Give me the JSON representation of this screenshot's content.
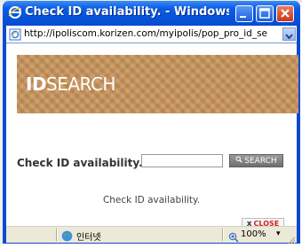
{
  "window": {
    "title": "Check ID availability. - Windows I...",
    "colors": {
      "titlebar": "#0553d8",
      "close_button": "#c6371b"
    }
  },
  "address_bar": {
    "url": "http://ipoliscom.korizen.com/myipolis/pop_pro_id_se"
  },
  "banner": {
    "title_bold": "ID",
    "title_light": "SEARCH",
    "color": "#c7935a"
  },
  "form": {
    "label": "Check ID availability.",
    "input_value": "",
    "search_button_label": "SEARCH",
    "search_icon": "magnifier-icon"
  },
  "message": "Check ID availability.",
  "close_button": {
    "icon": "x",
    "label": "CLOSE",
    "color": "#cc2222"
  },
  "status_bar": {
    "zone": "인터넷",
    "zoom": "100%"
  }
}
